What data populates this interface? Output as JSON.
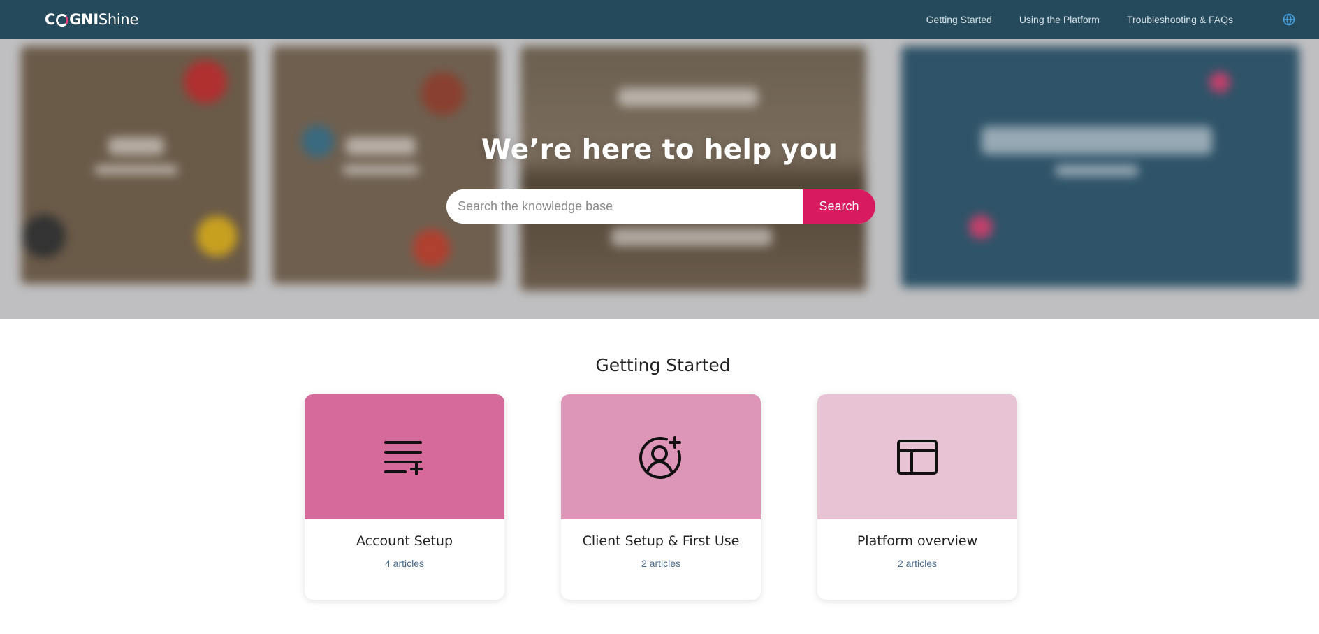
{
  "brand": {
    "logo_part1": "C",
    "logo_part2": "GNI",
    "logo_part3": "Shine"
  },
  "nav": {
    "links": [
      {
        "label": "Getting Started"
      },
      {
        "label": "Using the Platform"
      },
      {
        "label": "Troubleshooting & FAQs"
      }
    ],
    "language_icon": "globe-icon"
  },
  "hero": {
    "title": "We’re here to help you",
    "search_placeholder": "Search the knowledge base",
    "search_value": "",
    "search_button": "Search"
  },
  "section": {
    "title": "Getting Started",
    "cards": [
      {
        "title": "Account Setup",
        "count": "4 articles",
        "icon": "list-add-icon",
        "color": "#d46b9a"
      },
      {
        "title": "Client Setup & First Use",
        "count": "2 articles",
        "icon": "user-add-icon",
        "color": "#dd96b7"
      },
      {
        "title": "Platform overview",
        "count": "2 articles",
        "icon": "layout-icon",
        "color": "#e7c3d3"
      }
    ]
  },
  "colors": {
    "navbar": "#254a5b",
    "accent": "#d81b60",
    "link": "#4a6a8c"
  }
}
